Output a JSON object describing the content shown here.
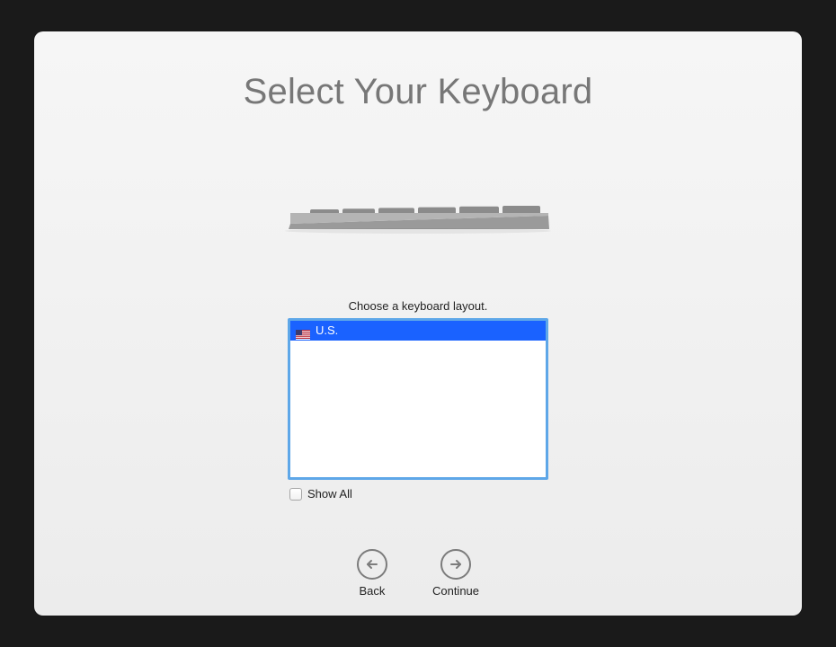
{
  "title": "Select Your Keyboard",
  "prompt": "Choose a keyboard layout.",
  "layouts": [
    {
      "label": "U.S.",
      "flag": "us-flag",
      "selected": true
    }
  ],
  "show_all": {
    "label": "Show All",
    "checked": false
  },
  "nav": {
    "back_label": "Back",
    "continue_label": "Continue"
  }
}
